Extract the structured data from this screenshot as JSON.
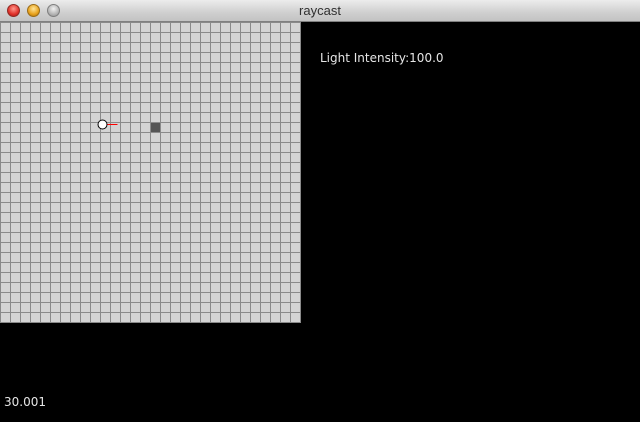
{
  "window": {
    "title": "raycast"
  },
  "hud": {
    "light_intensity_label": "Light Intensity:",
    "light_intensity_value": "100.0",
    "fps_value": "30.001"
  },
  "map": {
    "columns": 30,
    "rows": 30,
    "wall_cells": [
      [
        15,
        10
      ]
    ],
    "player": {
      "col": 10,
      "row": 10,
      "heading_deg": 0
    },
    "colors": {
      "floor": "#d4d4d4",
      "grid_line": "#8a8a8a",
      "wall": "#555555",
      "player_fill": "#ffffff",
      "player_outline": "#000000",
      "ray": "#ff0000",
      "background": "#000000"
    }
  },
  "icons": [
    "close-icon",
    "minimize-icon",
    "zoom-icon",
    "player-icon"
  ]
}
